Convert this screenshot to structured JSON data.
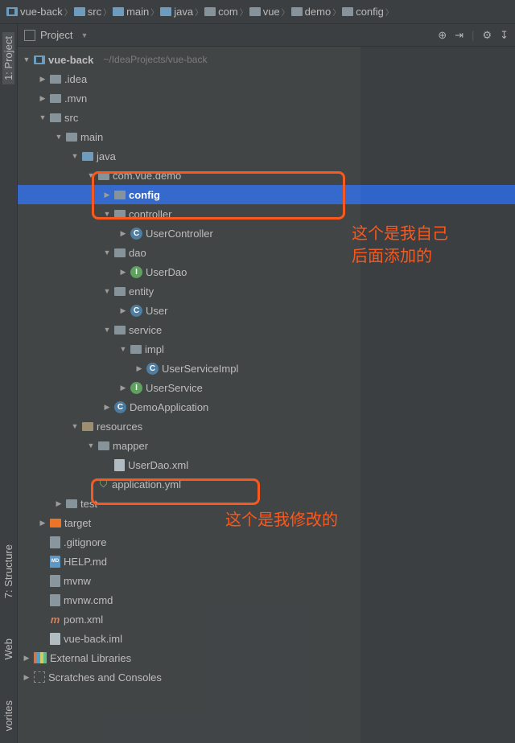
{
  "breadcrumbs": [
    {
      "icon": "module",
      "label": "vue-back"
    },
    {
      "icon": "src",
      "label": "src"
    },
    {
      "icon": "src",
      "label": "main"
    },
    {
      "icon": "src",
      "label": "java"
    },
    {
      "icon": "plain",
      "label": "com"
    },
    {
      "icon": "plain",
      "label": "vue"
    },
    {
      "icon": "plain",
      "label": "demo"
    },
    {
      "icon": "plain",
      "label": "config"
    }
  ],
  "panel": {
    "title": "Project"
  },
  "sidetabs": {
    "project": "1: Project",
    "structure": "7: Structure",
    "web": "Web",
    "favorites": "vorites"
  },
  "tree": {
    "root": {
      "label": "vue-back",
      "hint": "~/IdeaProjects/vue-back"
    },
    "idea": ".idea",
    "mvn": ".mvn",
    "src": "src",
    "main": "main",
    "java": "java",
    "pkg": "com.vue.demo",
    "config": "config",
    "controller": "controller",
    "usercontroller": "UserController",
    "dao": "dao",
    "userdao": "UserDao",
    "entity": "entity",
    "user": "User",
    "service": "service",
    "impl": "impl",
    "userserviceimpl": "UserServiceImpl",
    "userservice": "UserService",
    "demoapp": "DemoApplication",
    "resources": "resources",
    "mapper": "mapper",
    "userdaoxml": "UserDao.xml",
    "appyml": "application.yml",
    "test": "test",
    "target": "target",
    "gitignore": ".gitignore",
    "helpmd": "HELP.md",
    "mvnw": "mvnw",
    "mvnwcmd": "mvnw.cmd",
    "pom": "pom.xml",
    "iml": "vue-back.iml",
    "extlibs": "External Libraries",
    "scratches": "Scratches and Consoles"
  },
  "annotations": {
    "config_note": "这个是我自己\n后面添加的",
    "yml_note": "这个是我修改的"
  }
}
